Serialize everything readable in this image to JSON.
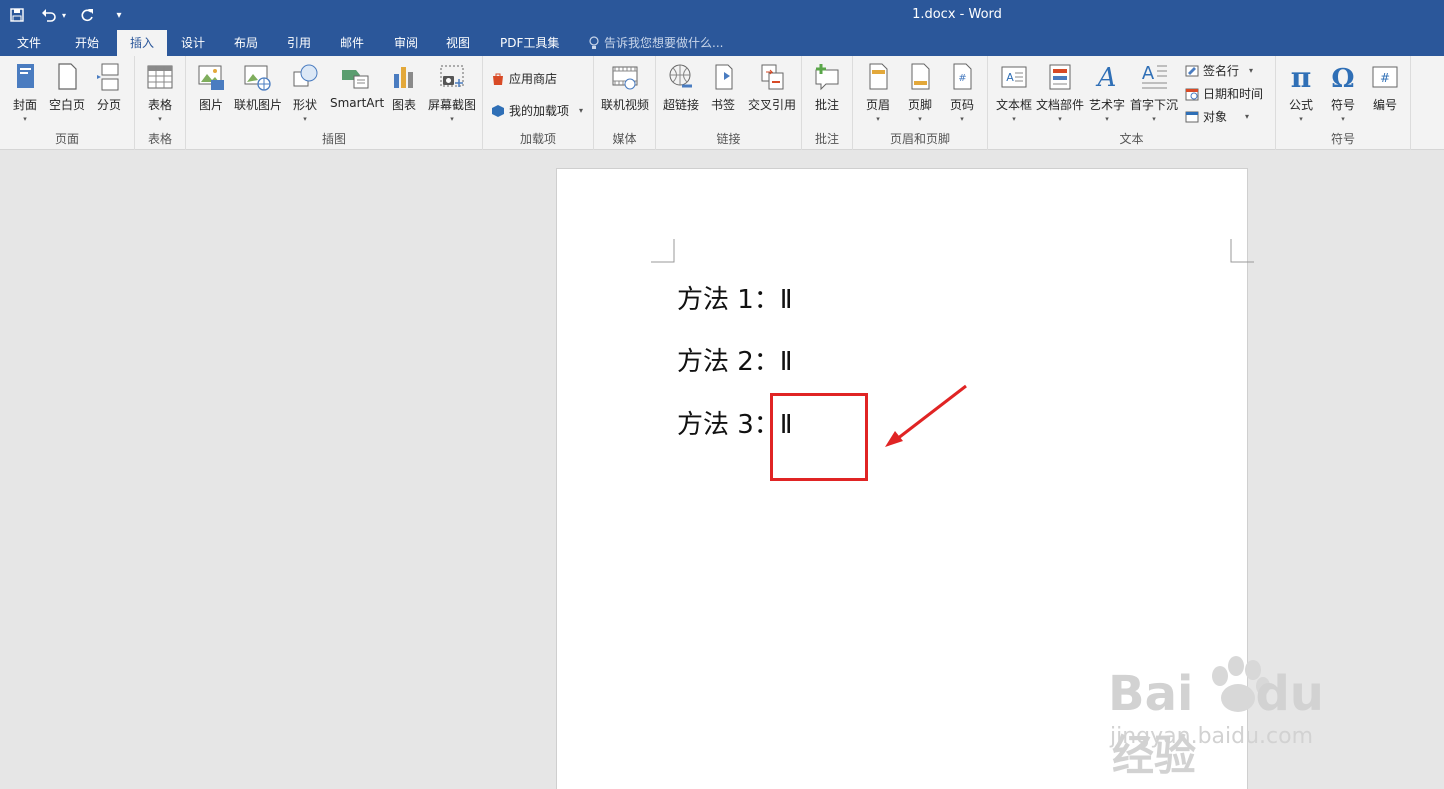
{
  "window": {
    "title": "1.docx - Word"
  },
  "qat": {
    "save_icon": "save-icon",
    "undo_icon": "undo-icon",
    "redo_icon": "redo-icon",
    "customize_icon": "customize-qat-icon"
  },
  "tabs": [
    {
      "label": "文件"
    },
    {
      "label": "开始"
    },
    {
      "label": "插入",
      "active": true
    },
    {
      "label": "设计"
    },
    {
      "label": "布局"
    },
    {
      "label": "引用"
    },
    {
      "label": "邮件"
    },
    {
      "label": "审阅"
    },
    {
      "label": "视图"
    },
    {
      "label": "PDF工具集"
    }
  ],
  "tellme": {
    "text": "告诉我您想要做什么..."
  },
  "ribbon": {
    "groups": {
      "pages": {
        "label": "页面",
        "cover": "封面",
        "blank": "空白页",
        "break": "分页"
      },
      "tables": {
        "label": "表格",
        "table": "表格"
      },
      "illustrations": {
        "label": "插图",
        "picture": "图片",
        "online_picture": "联机图片",
        "shapes": "形状",
        "smartart": "SmartArt",
        "chart": "图表",
        "screenshot": "屏幕截图"
      },
      "addins": {
        "label": "加载项",
        "store": "应用商店",
        "my_addins": "我的加载项"
      },
      "media": {
        "label": "媒体",
        "online_video": "联机视频"
      },
      "links": {
        "label": "链接",
        "hyperlink": "超链接",
        "bookmark": "书签",
        "cross_ref": "交叉引用"
      },
      "comments": {
        "label": "批注",
        "comment": "批注"
      },
      "header_footer": {
        "label": "页眉和页脚",
        "header": "页眉",
        "footer": "页脚",
        "page_number": "页码"
      },
      "text": {
        "label": "文本",
        "textbox": "文本框",
        "quick_parts": "文档部件",
        "wordart": "艺术字",
        "dropcap": "首字下沉",
        "signature": "签名行",
        "datetime": "日期和时间",
        "object": "对象"
      },
      "symbols": {
        "label": "符号",
        "equation": "公式",
        "symbol": "符号",
        "number": "编号"
      }
    }
  },
  "document": {
    "lines": [
      "方法 1：Ⅱ",
      "方法 2：Ⅱ",
      "方法 3：Ⅱ"
    ]
  },
  "annotation": {
    "box_color": "#e02424",
    "arrow_color": "#e02424"
  },
  "watermark": {
    "brand": "Bai",
    "brand2": "du",
    "cn": "经验",
    "url": "jingyan.baidu.com"
  },
  "colors": {
    "accent": "#2b579a",
    "ribbon_bg": "#f3f3f3",
    "canvas_bg": "#e6e6e6"
  }
}
